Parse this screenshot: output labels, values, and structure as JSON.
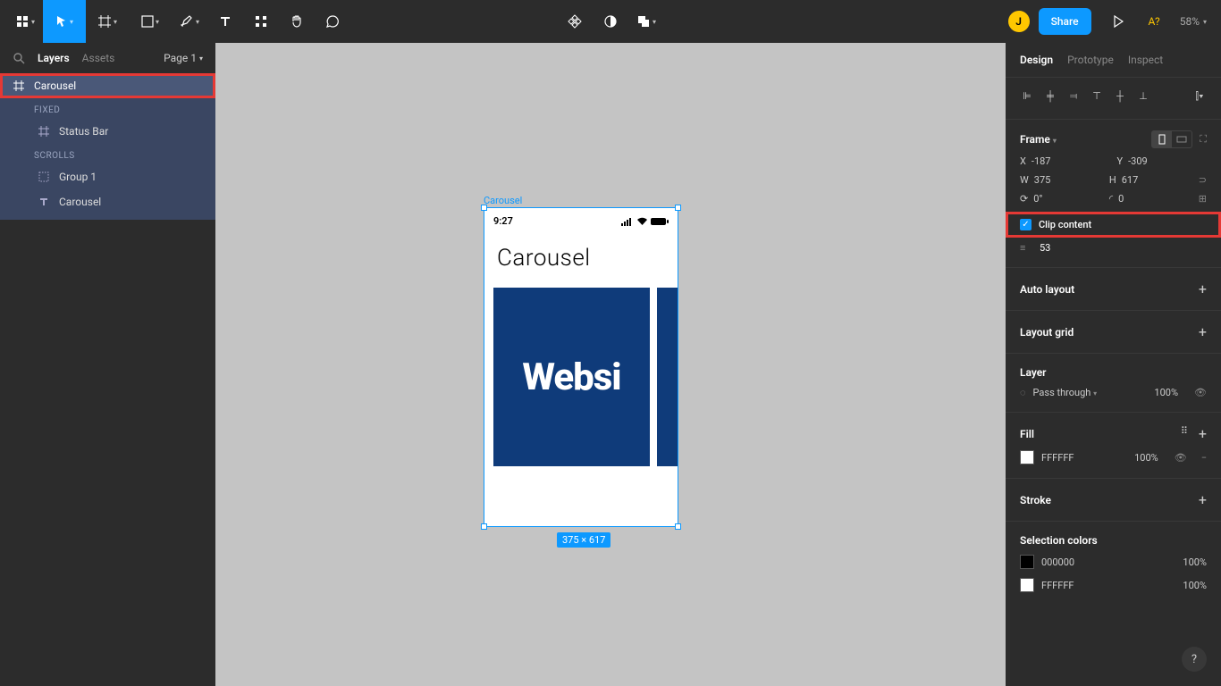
{
  "toolbar": {
    "avatar_initial": "J",
    "share_label": "Share",
    "unsaved_indicator": "A?",
    "zoom_value": "58%"
  },
  "left_panel": {
    "tabs": {
      "layers": "Layers",
      "assets": "Assets"
    },
    "page_label": "Page 1",
    "tree": {
      "root": "Carousel",
      "fixed_label": "FIXED",
      "fixed_items": [
        "Status Bar"
      ],
      "scrolls_label": "SCROLLS",
      "scrolls_items": [
        "Group 1",
        "Carousel"
      ]
    }
  },
  "canvas": {
    "frame_label": "Carousel",
    "size_badge": "375 × 617",
    "status_time": "9:27",
    "carousel_title": "Carousel",
    "card_text": "Websi"
  },
  "right_panel": {
    "tabs": {
      "design": "Design",
      "prototype": "Prototype",
      "inspect": "Inspect"
    },
    "frame": {
      "title": "Frame",
      "x": "-187",
      "y": "-309",
      "w": "375",
      "h": "617",
      "rotation": "0°",
      "radius": "0",
      "clip_content_label": "Clip content",
      "spacing": "53"
    },
    "auto_layout_title": "Auto layout",
    "layout_grid_title": "Layout grid",
    "layer": {
      "title": "Layer",
      "blend": "Pass through",
      "opacity": "100%"
    },
    "fill": {
      "title": "Fill",
      "color": "FFFFFF",
      "opacity": "100%"
    },
    "stroke_title": "Stroke",
    "selection_colors": {
      "title": "Selection colors",
      "items": [
        {
          "hex": "000000",
          "opacity": "100%",
          "swatch": "#000000"
        },
        {
          "hex": "FFFFFF",
          "opacity": "100%",
          "swatch": "#ffffff"
        }
      ]
    }
  },
  "help_label": "?"
}
